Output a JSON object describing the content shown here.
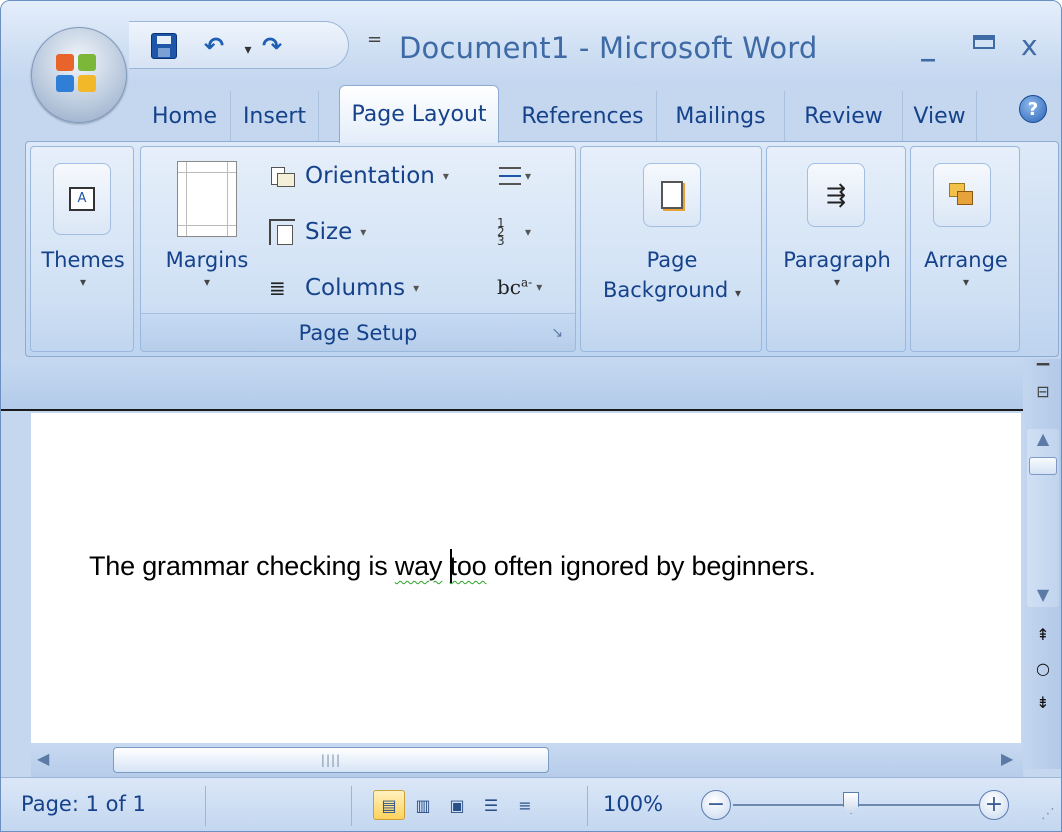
{
  "window": {
    "title": "Document1 - Microsoft Word",
    "minimize": "_",
    "close": "x"
  },
  "qat": {
    "save_icon": "save-icon",
    "undo_icon": "undo-icon",
    "undo_dropdown": "▾",
    "redo_icon": "redo-icon",
    "customize": "="
  },
  "tabs": [
    {
      "label": "Home",
      "active": false
    },
    {
      "label": "Insert",
      "active": false
    },
    {
      "label": "Page Layout",
      "active": true
    },
    {
      "label": "References",
      "active": false
    },
    {
      "label": "Mailings",
      "active": false
    },
    {
      "label": "Review",
      "active": false
    },
    {
      "label": "View",
      "active": false
    }
  ],
  "help": "?",
  "ribbon": {
    "themes": {
      "label": "Themes",
      "arrow": "▾"
    },
    "page_setup": {
      "label": "Page Setup",
      "margins": {
        "label": "Margins",
        "arrow": "▾"
      },
      "orientation": {
        "label": "Orientation",
        "arrow": "▾"
      },
      "size": {
        "label": "Size",
        "arrow": "▾"
      },
      "columns": {
        "label": "Columns",
        "arrow": "▾"
      },
      "hyphenation_label": "bc",
      "hyphenation_sup": "a-",
      "launcher": "↘"
    },
    "page_background": {
      "label_line1": "Page",
      "label_line2": "Background",
      "arrow": "▾"
    },
    "paragraph": {
      "label": "Paragraph",
      "arrow": "▾"
    },
    "arrange": {
      "label": "Arrange",
      "arrow": "▾"
    }
  },
  "document": {
    "text_before": "The grammar checking is ",
    "flagged_1": "way",
    "flagged_2": "too",
    "text_after": " often ignored by beginners."
  },
  "scrollbars": {
    "hthumb_grip": "||||"
  },
  "status": {
    "page": "Page: 1 of 1",
    "zoom": "100%",
    "zoom_out": "−",
    "zoom_in": "+"
  },
  "colors": {
    "accent": "#15428b",
    "ribbon_bg": "#c8dbf2",
    "spell_underline": "#2aa52a",
    "active_view": "#ffd35c"
  }
}
